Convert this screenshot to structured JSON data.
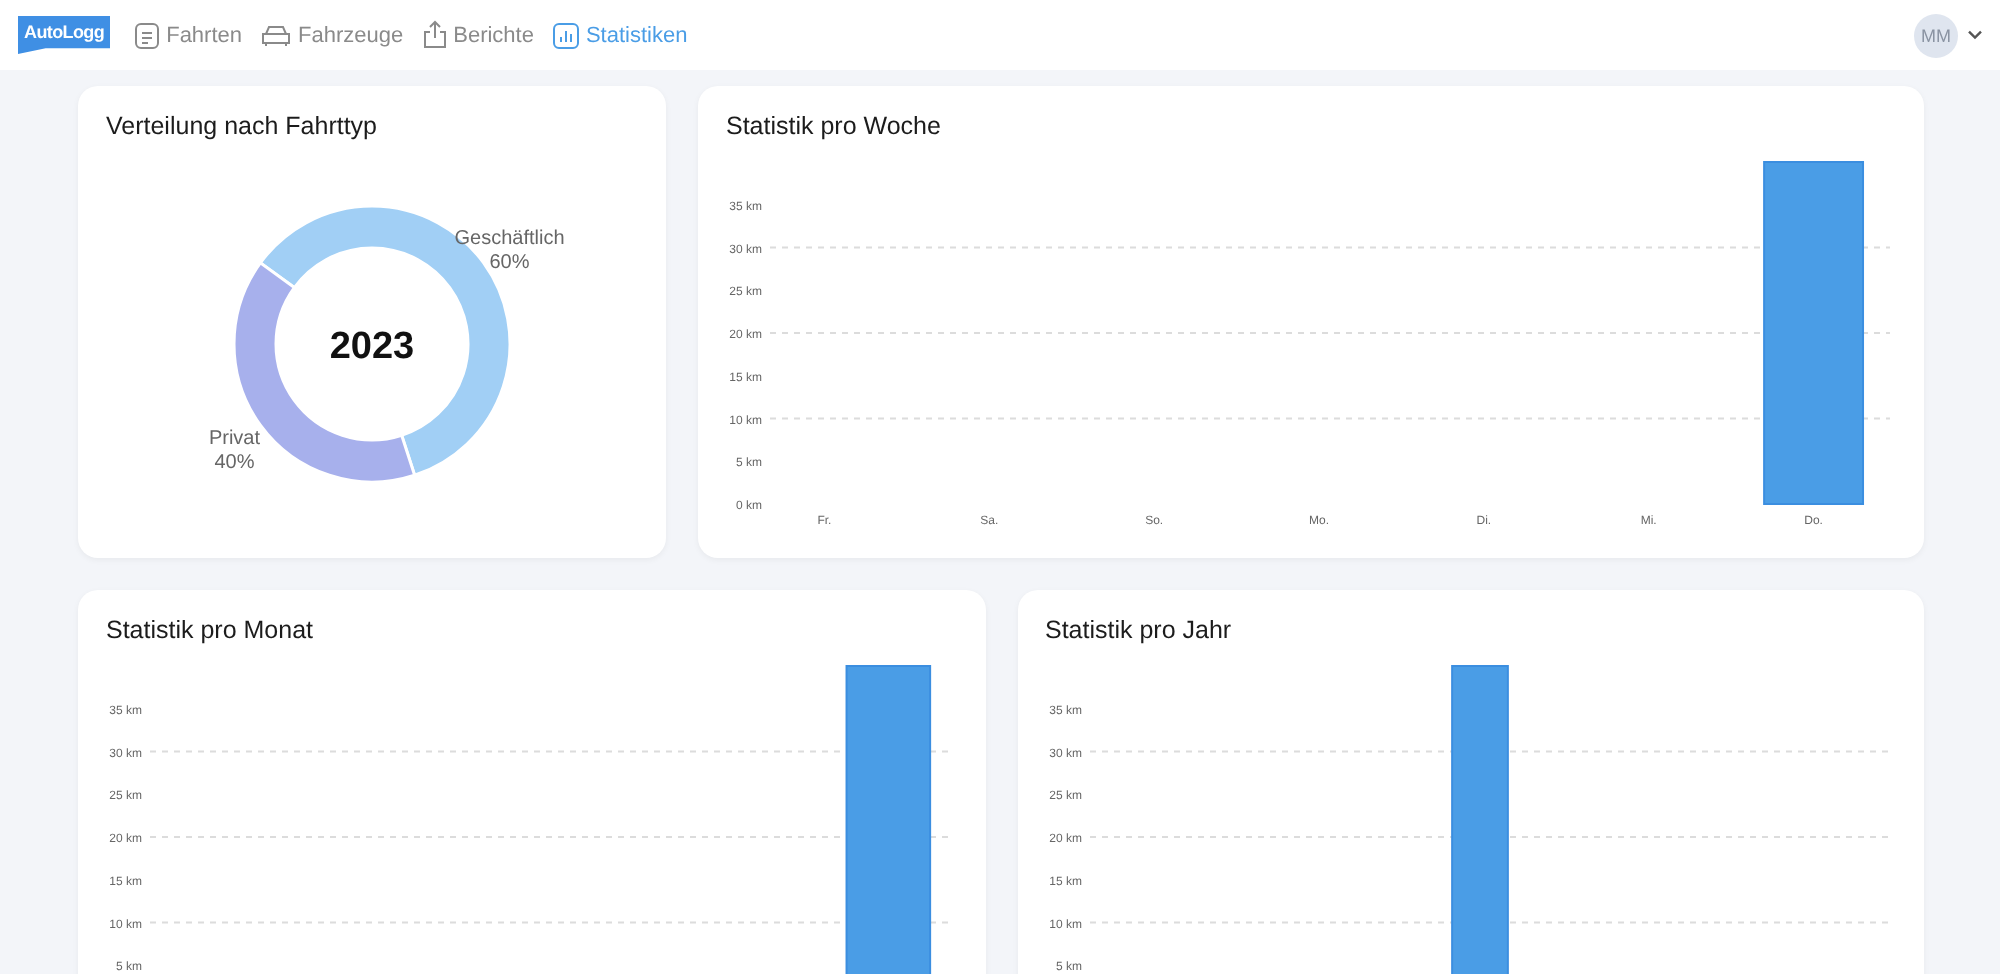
{
  "header": {
    "logo": "AutoLogg",
    "nav": [
      {
        "label": "Fahrten",
        "selected": false
      },
      {
        "label": "Fahrzeuge",
        "selected": false
      },
      {
        "label": "Berichte",
        "selected": false
      },
      {
        "label": "Statistiken",
        "selected": true
      }
    ],
    "user": {
      "initials": "MM"
    }
  },
  "cards": [
    {
      "title": "Verteilung nach Fahrttyp",
      "center_text": "2023",
      "chart_data": {
        "type": "donut",
        "categories": [
          "Geschäftlich",
          "Privat"
        ],
        "values": [
          60,
          40
        ],
        "colors": [
          "#a1cff5",
          "#a7b0ec"
        ],
        "value_labels": [
          "60%",
          "40%"
        ]
      }
    },
    {
      "title": "Statistik pro Woche",
      "chart_data": {
        "type": "bar",
        "grid": true,
        "categories": [
          "Fr.",
          "Sa.",
          "So.",
          "Mo.",
          "Di.",
          "Mi.",
          "Do."
        ],
        "values": [
          0,
          0,
          0,
          0,
          0,
          0,
          40
        ],
        "ylim": [
          0,
          40
        ],
        "yticks": [
          {
            "value": 0,
            "label": "0 km"
          },
          {
            "value": 5,
            "label": "5 km"
          },
          {
            "value": 10,
            "label": "10 km"
          },
          {
            "value": 15,
            "label": "15 km"
          },
          {
            "value": 20,
            "label": "20 km"
          },
          {
            "value": 25,
            "label": "25 km"
          },
          {
            "value": 30,
            "label": "30 km"
          },
          {
            "value": 35,
            "label": "35 km"
          }
        ]
      }
    },
    {
      "title": "Statistik pro Monat",
      "chart_data": {
        "type": "bar",
        "grid": true,
        "values": [
          null,
          null,
          null,
          null,
          null,
          40
        ],
        "ylim": [
          0,
          40
        ],
        "yticks": [
          {
            "value": 5,
            "label": "5 km"
          },
          {
            "value": 10,
            "label": "10 km"
          },
          {
            "value": 15,
            "label": "15 km"
          },
          {
            "value": 20,
            "label": "20 km"
          },
          {
            "value": 25,
            "label": "25 km"
          },
          {
            "value": 30,
            "label": "30 km"
          },
          {
            "value": 35,
            "label": "35 km"
          }
        ]
      }
    },
    {
      "title": "Statistik pro Jahr",
      "chart_data": {
        "type": "bar",
        "grid": true,
        "values": [
          null,
          null,
          null,
          null,
          40,
          null,
          null,
          null,
          null
        ],
        "ylim": [
          0,
          40
        ],
        "yticks": [
          {
            "value": 5,
            "label": "5 km"
          },
          {
            "value": 10,
            "label": "10 km"
          },
          {
            "value": 15,
            "label": "15 km"
          },
          {
            "value": 20,
            "label": "20 km"
          },
          {
            "value": 25,
            "label": "25 km"
          },
          {
            "value": 30,
            "label": "30 km"
          },
          {
            "value": 35,
            "label": "35 km"
          }
        ]
      }
    }
  ]
}
